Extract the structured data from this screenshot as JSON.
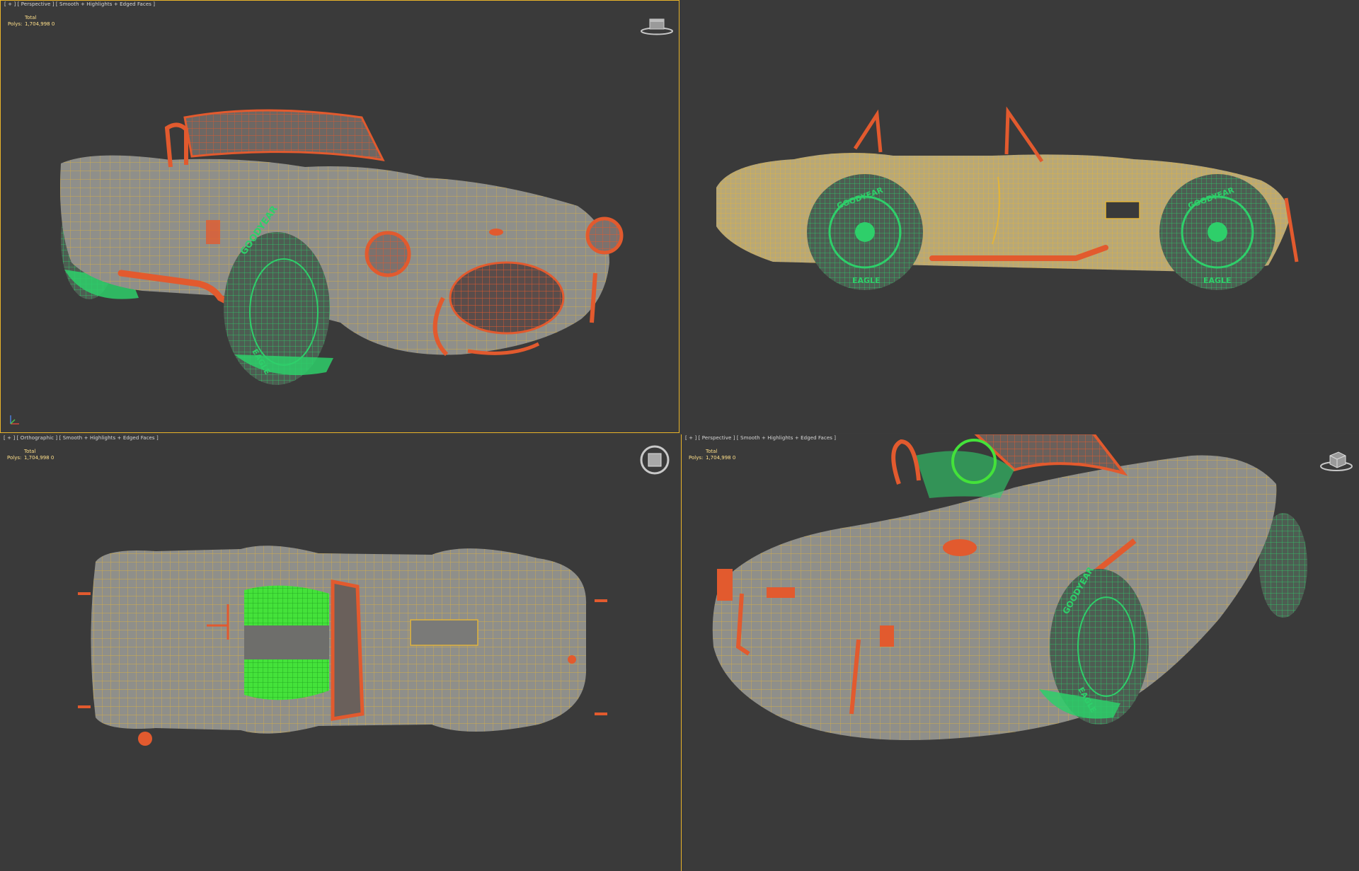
{
  "viewports": [
    {
      "label": "[ + ] [ Perspective ] [ Smooth + Highlights + Edged Faces ]",
      "stats_header": "Total",
      "stats_key": "Polys:",
      "stats_value": "1,704,998  0"
    },
    {
      "label": "",
      "stats_header": "",
      "stats_key": "",
      "stats_value": ""
    },
    {
      "label": "[ + ] [ Orthographic ] [ Smooth + Highlights + Edged Faces ]",
      "stats_header": "Total",
      "stats_key": "Polys:",
      "stats_value": "1,704,998  0"
    },
    {
      "label": "[ + ] [ Perspective ] [ Smooth + Highlights + Edged Faces ]",
      "stats_header": "Total",
      "stats_key": "Polys:",
      "stats_value": "1,704,998  0"
    }
  ],
  "tire_text": {
    "brand": "GOODYEAR",
    "model": "EAGLE"
  },
  "icons": [
    "viewcube-icon",
    "axis-tripod-icon"
  ],
  "colors": {
    "viewport_bg": "#3a3a3a",
    "active_border": "#e8b32a",
    "body_shell": "#8f8f8a",
    "wire_yellow": "#e2b43a",
    "wire_orange": "#e25a2e",
    "wire_green": "#2ecf6a",
    "wire_bright_green": "#44e23a"
  }
}
